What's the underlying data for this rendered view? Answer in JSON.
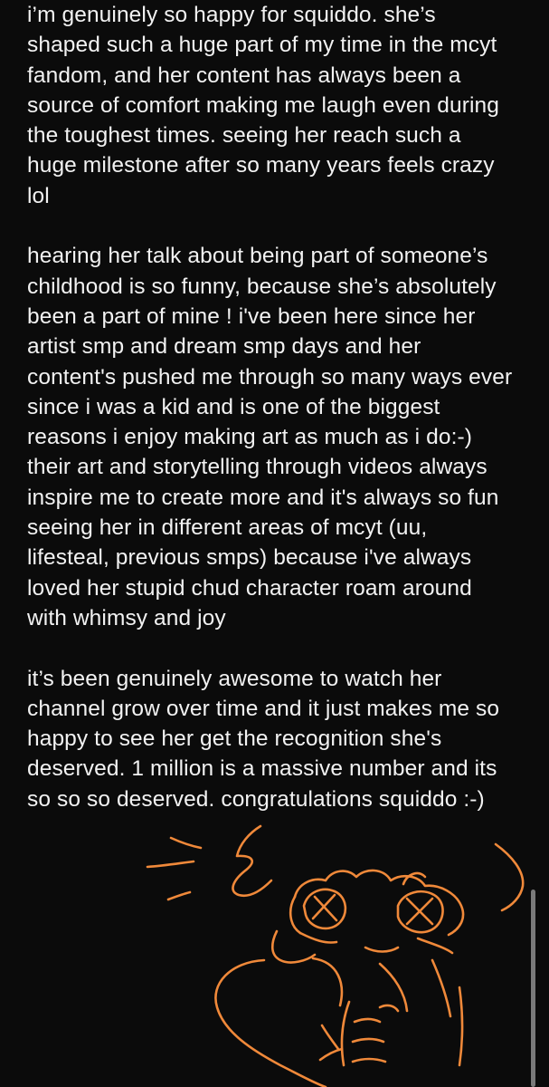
{
  "note": {
    "paragraphs": [
      {
        "lines": [
          "i’m genuinely so happy for squiddo. she’s",
          "shaped such a huge part of my time in the mcyt",
          "fandom, and her content has always been a",
          "source of comfort making me laugh even during",
          "the toughest times. seeing her reach such a",
          "huge milestone after so many years feels crazy",
          "lol"
        ]
      },
      {
        "lines": [
          "hearing her talk about being part of someone’s",
          "childhood is so funny, because she’s absolutely",
          "been a part of mine ! i've been here since her",
          "artist smp and dream smp days and her",
          "content's pushed me through so many ways ever",
          "since i was a kid and is one of the biggest",
          "reasons i enjoy making art as much as i do:-)",
          "their art and storytelling through videos always",
          "inspire me to create more and it's always so fun",
          "seeing her in different areas of mcyt (uu,",
          "lifesteal, previous smps) because i've always",
          "loved her stupid chud character roam around",
          "with whimsy and joy"
        ]
      },
      {
        "lines": [
          "it’s been genuinely awesome to watch her",
          "channel grow over time and it just makes me so",
          "happy to see her get the recognition she's",
          "deserved. 1 million is a massive number and its",
          "so so so deserved. congratulations squiddo :-)"
        ]
      }
    ]
  },
  "drawing": {
    "stroke_color": "#f0893a",
    "description_icon": "hand-drawn-character-doodle"
  },
  "colors": {
    "background": "#0b0b0b",
    "text": "#f2f2f2",
    "scrollbar": "#7a7a7a"
  }
}
